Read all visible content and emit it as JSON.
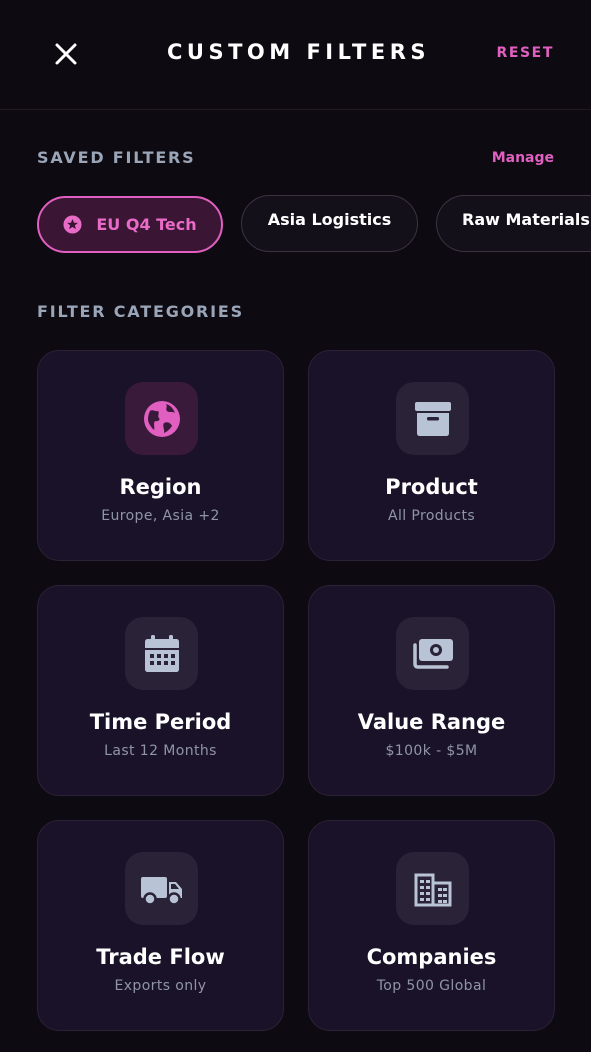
{
  "header": {
    "title": "CUSTOM FILTERS",
    "reset_label": "RESET",
    "close_icon": "close-icon"
  },
  "saved_filters": {
    "label": "SAVED FILTERS",
    "manage_label": "Manage",
    "chips": [
      {
        "label": "EU Q4 Tech",
        "active": true,
        "icon": "star-circle-icon"
      },
      {
        "label": "Asia Logistics",
        "active": false
      },
      {
        "label": "Raw Materials",
        "active": false
      }
    ]
  },
  "categories": {
    "label": "FILTER CATEGORIES",
    "cards": [
      {
        "name": "Region",
        "value": "Europe, Asia +2",
        "icon": "globe-icon"
      },
      {
        "name": "Product",
        "value": "All Products",
        "icon": "archive-box-icon"
      },
      {
        "name": "Time Period",
        "value": "Last 12 Months",
        "icon": "calendar-icon"
      },
      {
        "name": "Value Range",
        "value": "$100k - $5M",
        "icon": "money-icon"
      },
      {
        "name": "Trade Flow",
        "value": "Exports only",
        "icon": "truck-icon"
      },
      {
        "name": "Companies",
        "value": "Top 500 Global",
        "icon": "building-icon"
      }
    ]
  },
  "colors": {
    "accent": "#e05fc0",
    "background": "#0e0a12",
    "card": "#1a1228",
    "icon_muted": "#b9c3d6"
  }
}
